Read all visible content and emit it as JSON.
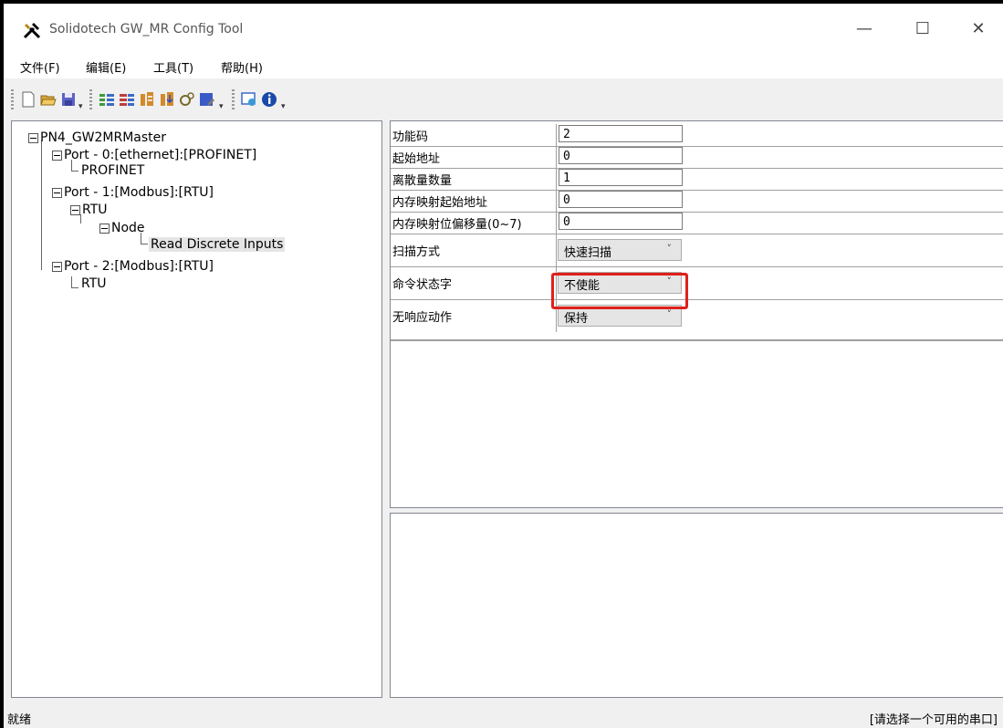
{
  "window": {
    "title": "Solidotech GW_MR Config Tool",
    "controls": [
      "—",
      "☐",
      "✕"
    ]
  },
  "menu": [
    "文件(F)",
    "编辑(E)",
    "工具(T)",
    "帮助(H)"
  ],
  "toolbar": {
    "icons": [
      "new-file-icon",
      "open-folder-icon",
      "save-icon",
      "add-port-icon",
      "add-node-icon",
      "read-icon",
      "write-icon",
      "settings-icon",
      "download-icon",
      "monitor-icon",
      "info-icon"
    ]
  },
  "tree": {
    "root": "PN4_GW2MRMaster",
    "port0": "Port - 0:[ethernet]:[PROFINET]",
    "port0_child": "PROFINET",
    "port1": "Port - 1:[Modbus]:[RTU]",
    "port1_rtu": "RTU",
    "node": "Node",
    "read_inputs": "Read Discrete Inputs",
    "port2": "Port - 2:[Modbus]:[RTU]",
    "port2_rtu": "RTU"
  },
  "properties": [
    {
      "label": "功能码",
      "value": "2"
    },
    {
      "label": "起始地址",
      "value": "0"
    },
    {
      "label": "离散量数量",
      "value": "1"
    },
    {
      "label": "内存映射起始地址",
      "value": "0"
    },
    {
      "label": "内存映射位偏移量(0~7)",
      "value": "0"
    },
    {
      "label": "扫描方式",
      "value": "快速扫描"
    },
    {
      "label": "命令状态字",
      "value": "不使能"
    },
    {
      "label": "无响应动作",
      "value": "保持"
    }
  ],
  "status": {
    "left": "就绪",
    "right": "[请选择一个可用的串口]"
  },
  "colors": {
    "highlight": "#e0201b",
    "selection": "#e5e5e5"
  }
}
